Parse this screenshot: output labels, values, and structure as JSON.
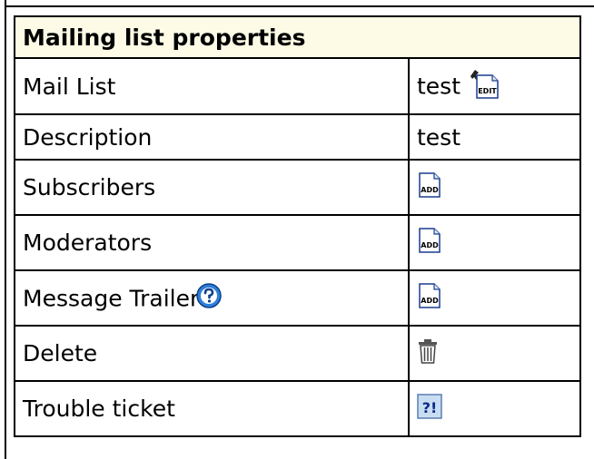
{
  "table": {
    "title": "Mailing list properties",
    "rows": [
      {
        "label": "Mail List",
        "value": "test",
        "icon": "edit-icon"
      },
      {
        "label": "Description",
        "value": "test"
      },
      {
        "label": "Subscribers",
        "icon": "add-icon"
      },
      {
        "label": "Moderators",
        "icon": "add-icon"
      },
      {
        "label": "Message Trailer",
        "help_icon": "help-icon",
        "icon": "add-icon"
      },
      {
        "label": "Delete",
        "icon": "trash-icon"
      },
      {
        "label": "Trouble ticket",
        "icon": "trouble-ticket-icon"
      }
    ]
  },
  "icons": {
    "add_text": "ADD",
    "edit_text": "EDIT",
    "ticket_text": "?!"
  },
  "colors": {
    "header_bg": "#fdfbe6",
    "border": "#000000",
    "help_blue": "#2f7fd6",
    "ticket_bg": "#c9ddf2",
    "ticket_fg": "#0b2a8a"
  }
}
